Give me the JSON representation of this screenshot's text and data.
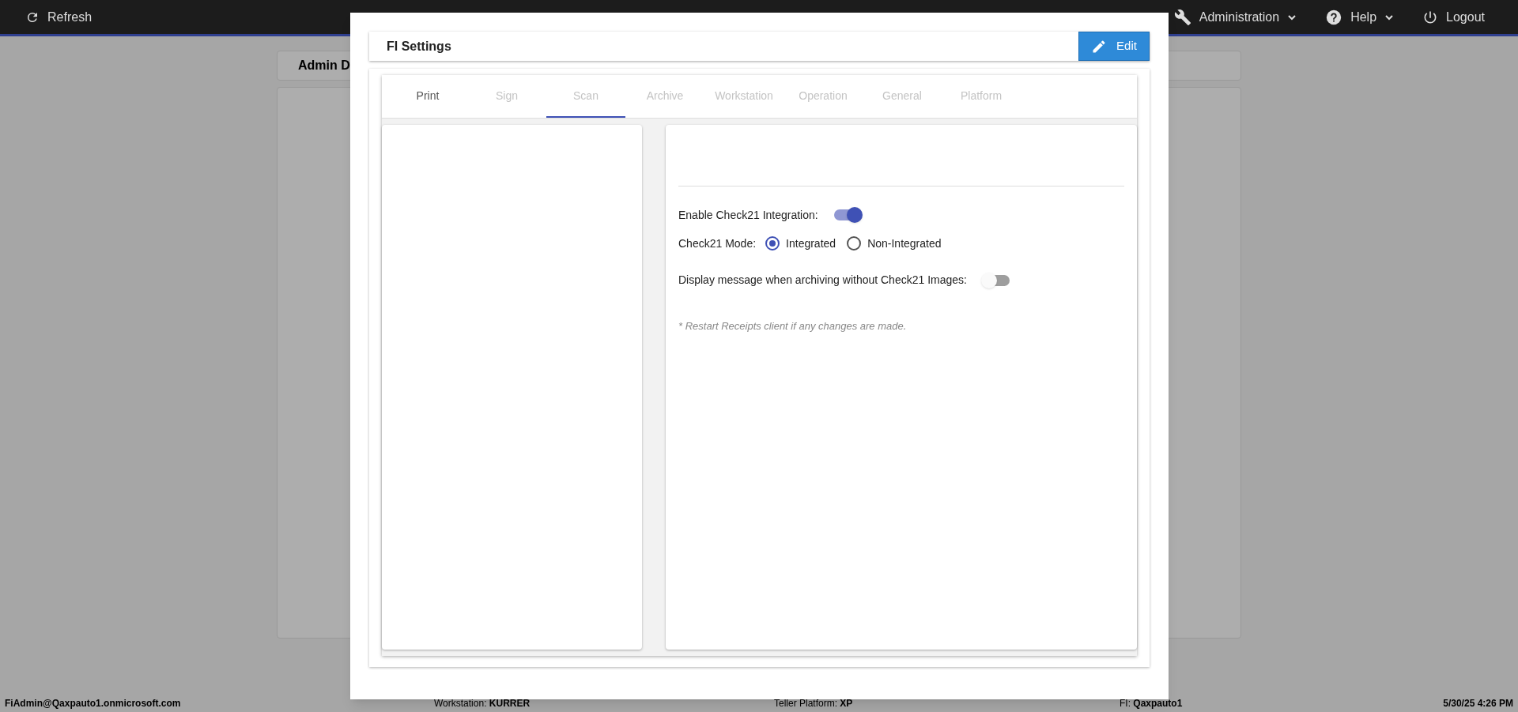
{
  "top_bar": {
    "left": [
      {
        "kind": "refresh",
        "label": "Refresh"
      }
    ],
    "right": [
      {
        "kind": "wrench",
        "label": "Administration",
        "dropdown": true
      },
      {
        "kind": "help",
        "label": "Help",
        "dropdown": true
      },
      {
        "kind": "power",
        "label": "Logout",
        "dropdown": false
      }
    ]
  },
  "background": {
    "card_title": "Admin D"
  },
  "modal": {
    "title": "FI Settings",
    "edit_button": "Edit",
    "tabs": [
      {
        "label": "Print",
        "selected": false,
        "disabled": false
      },
      {
        "label": "Sign",
        "selected": false,
        "disabled": true
      },
      {
        "label": "Scan",
        "selected": true,
        "disabled": true
      },
      {
        "label": "Archive",
        "selected": false,
        "disabled": true
      },
      {
        "label": "Workstation",
        "selected": false,
        "disabled": true
      },
      {
        "label": "Operation",
        "selected": false,
        "disabled": true
      },
      {
        "label": "General",
        "selected": false,
        "disabled": true
      },
      {
        "label": "Platform",
        "selected": false,
        "disabled": true
      }
    ],
    "settings": [
      {
        "kind": "toggle",
        "label": "Enable Check21 Integration:",
        "on": true
      },
      {
        "kind": "radio",
        "label": "Check21 Mode:",
        "options": [
          {
            "label": "Integrated",
            "selected": true
          },
          {
            "label": "Non-Integrated",
            "selected": false
          }
        ]
      },
      {
        "kind": "toggle",
        "label": "Display message when archiving without Check21 Images:",
        "on": false
      }
    ],
    "note": "* Restart Receipts client if any changes are made."
  },
  "status_bar": [
    "FiAdmin@Qaxpauto1.onmicrosoft.com",
    "Workstation: **KURRER**",
    "Teller Platform: **XP**",
    "FI: **Qaxpauto1**",
    "5/30/25 4:26 PM"
  ]
}
